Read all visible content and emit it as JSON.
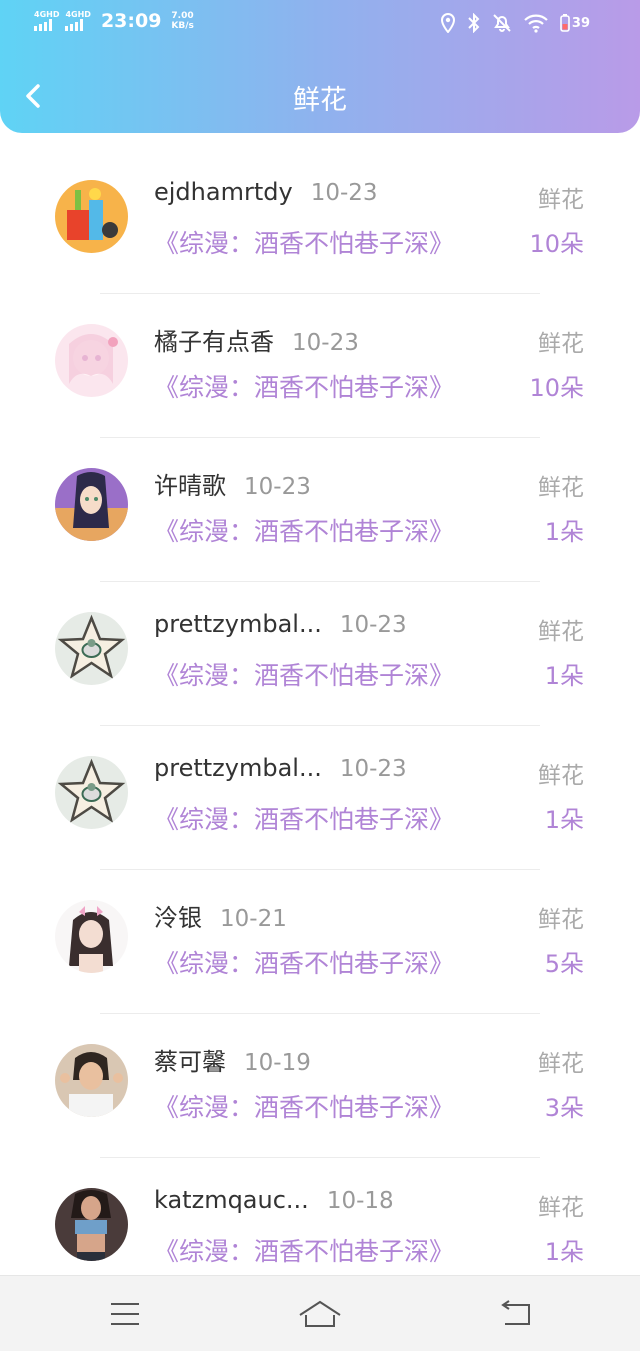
{
  "status_bar": {
    "net1": "4GHD",
    "net2": "4GHD",
    "time": "23:09",
    "speed_value": "7.00",
    "speed_unit": "KB/s",
    "battery": "39"
  },
  "header": {
    "title": "鲜花",
    "back_icon": "chevron-left-icon"
  },
  "colors": {
    "header_gradient_start": "#5fd3f5",
    "header_gradient_end": "#b99be8",
    "accent_purple": "#b084d6"
  },
  "records": [
    {
      "name": "ejdhamrtdy",
      "date": "10-23",
      "book": "《综漫：酒香不怕巷子深》",
      "gift": "鲜花",
      "count": "10朵"
    },
    {
      "name": "橘子有点香",
      "date": "10-23",
      "book": "《综漫：酒香不怕巷子深》",
      "gift": "鲜花",
      "count": "10朵"
    },
    {
      "name": "许晴歌",
      "date": "10-23",
      "book": "《综漫：酒香不怕巷子深》",
      "gift": "鲜花",
      "count": "1朵"
    },
    {
      "name": "prettzymbal...",
      "date": "10-23",
      "book": "《综漫：酒香不怕巷子深》",
      "gift": "鲜花",
      "count": "1朵"
    },
    {
      "name": "prettzymbal...",
      "date": "10-23",
      "book": "《综漫：酒香不怕巷子深》",
      "gift": "鲜花",
      "count": "1朵"
    },
    {
      "name": "泠银",
      "date": "10-21",
      "book": "《综漫：酒香不怕巷子深》",
      "gift": "鲜花",
      "count": "5朵"
    },
    {
      "name": "蔡可馨",
      "date": "10-19",
      "book": "《综漫：酒香不怕巷子深》",
      "gift": "鲜花",
      "count": "3朵"
    },
    {
      "name": "katzmqauc...",
      "date": "10-18",
      "book": "《综漫：酒香不怕巷子深》",
      "gift": "鲜花",
      "count": "1朵"
    }
  ],
  "bottom_nav": {
    "menu_icon": "menu-icon",
    "home_icon": "home-icon",
    "back_icon": "return-icon"
  }
}
